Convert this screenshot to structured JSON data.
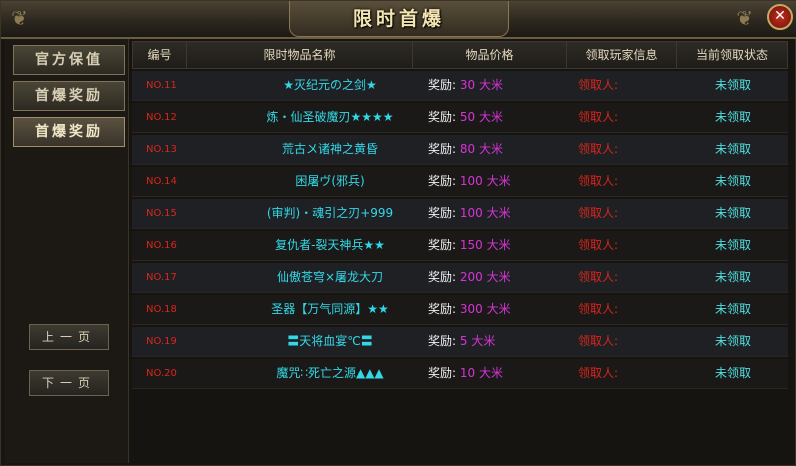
{
  "title": "限时首爆",
  "sidebar": {
    "items": [
      {
        "label": "官方保值"
      },
      {
        "label": "首爆奖励"
      },
      {
        "label": "首爆奖励"
      }
    ],
    "prev_page": "上一页",
    "next_page": "下一页"
  },
  "table": {
    "headers": [
      "编号",
      "限时物品名称",
      "物品价格",
      "领取玩家信息",
      "当前领取状态"
    ],
    "rows": [
      {
        "no": "NO.11",
        "name": "★灭纪元の之剑★",
        "price_label": "奖励:",
        "price": "30",
        "unit": "大米",
        "player": "领取人:",
        "status": "未领取"
      },
      {
        "no": "NO.12",
        "name": "炼・仙圣破魔刃★★★★",
        "price_label": "奖励:",
        "price": "50",
        "unit": "大米",
        "player": "领取人:",
        "status": "未领取"
      },
      {
        "no": "NO.13",
        "name": "荒古〤诸神之黄昏",
        "price_label": "奖励:",
        "price": "80",
        "unit": "大米",
        "player": "领取人:",
        "status": "未领取"
      },
      {
        "no": "NO.14",
        "name": "困屠ヴ(邪兵)",
        "price_label": "奖励:",
        "price": "100",
        "unit": "大米",
        "player": "领取人:",
        "status": "未领取"
      },
      {
        "no": "NO.15",
        "name": "(审判)・魂引之刃+999",
        "price_label": "奖励:",
        "price": "100",
        "unit": "大米",
        "player": "领取人:",
        "status": "未领取"
      },
      {
        "no": "NO.16",
        "name": "复仇者-裂天神兵★★",
        "price_label": "奖励:",
        "price": "150",
        "unit": "大米",
        "player": "领取人:",
        "status": "未领取"
      },
      {
        "no": "NO.17",
        "name": "仙傲苍穹×屠龙大刀",
        "price_label": "奖励:",
        "price": "200",
        "unit": "大米",
        "player": "领取人:",
        "status": "未领取"
      },
      {
        "no": "NO.18",
        "name": "圣器【万气同源】★★",
        "price_label": "奖励:",
        "price": "300",
        "unit": "大米",
        "player": "领取人:",
        "status": "未领取"
      },
      {
        "no": "NO.19",
        "name": "〓天将血宴℃〓",
        "price_label": "奖励:",
        "price": "5",
        "unit": "大米",
        "player": "领取人:",
        "status": "未领取"
      },
      {
        "no": "NO.20",
        "name": "魔咒∷死亡之源▲▲▲",
        "price_label": "奖励:",
        "price": "10",
        "unit": "大米",
        "player": "领取人:",
        "status": "未领取"
      }
    ]
  },
  "colors": {
    "number": "#d8261d",
    "item_name": "#33d8e8",
    "price": "#d634d6",
    "status": "#4fe0e0"
  },
  "icons": {
    "close": "close-icon"
  }
}
